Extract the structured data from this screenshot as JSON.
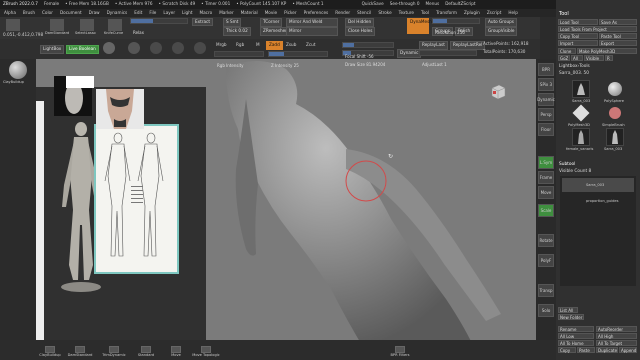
{
  "titlebar": {
    "app": "ZBrush 2022.0.7",
    "file": "Female",
    "free_mem": "• Free Mem 18.16GB",
    "active_mem": "• Active Mem 976",
    "scratch": "• Scratch Disk 49",
    "timer": "• Timer 0.001",
    "polycount": "• PolyCount 145.107 KP",
    "meshcount": "• MeshCount 1",
    "quicksave": "QuickSave",
    "seethrough": "See-through 0",
    "menus": "Menus",
    "default": "DefaultZScript"
  },
  "menu": [
    "Alpha",
    "Brush",
    "Color",
    "Document",
    "Draw",
    "Dynamics",
    "Edit",
    "File",
    "Layer",
    "Light",
    "Macro",
    "Marker",
    "Material",
    "Movie",
    "Picker",
    "Preferences",
    "Render",
    "Stencil",
    "Stroke",
    "Texture",
    "Tool",
    "Transform",
    "Zplugin",
    "Zscript",
    "Help"
  ],
  "shelf1": {
    "coords": "0.051,-0.412,0.798",
    "brushes": [
      "MoveBrush",
      "DamStandard",
      "SelectLasso",
      "KnifeCurve"
    ],
    "relax": "Relax",
    "extract": "Extract",
    "s_smt": "S Smt",
    "thick": "Thick 0.02",
    "tcorner": "TCorner",
    "tborder": "TBorder",
    "zremesher": "ZRemesher",
    "mirror_weld": "Mirror And Weld",
    "del_hidden": "Del Hidden",
    "mirror": "Mirror",
    "close_holes": "Close Holes",
    "dynamesh": "DynaMesh",
    "resolution": "Resolution 256",
    "groups": "Groups",
    "polish": "Polish",
    "auto_groups": "Auto Groups",
    "group_visible": "GroupVisible"
  },
  "shelf2": {
    "lightbox": "LightBox",
    "live_boolean": "Live Boolean",
    "mrgb": "Mrgb",
    "rgb": "Rgb",
    "m": "M",
    "zadd": "Zadd",
    "zsub": "Zsub",
    "zcut": "Zcut",
    "rgb_intensity": "Rgb Intensity",
    "z_intensity": "Z Intensity 25",
    "focal_shift": "Focal Shift -56",
    "draw_size": "Draw Size 81.94204",
    "dynamic": "Dynamic",
    "replay_last": "ReplayLast",
    "replay_last_rel": "ReplayLastRel",
    "active_points": "ActivePoints: 162,918",
    "total_points": "TotalPoints: 170,630",
    "adjust_last": "AdjustLast 1"
  },
  "left": {
    "brush": "ClayBuildup"
  },
  "canvas": {
    "pointer_label": "o"
  },
  "rightstrip": [
    "BPR",
    "SPix 3",
    "Dynamic",
    "Persp",
    "Floor",
    "L.Sym",
    "Frame",
    "Move",
    "Scale",
    "Rotate",
    "PolyF",
    "Transp",
    "Solo"
  ],
  "toolpanel": {
    "header": "Tool",
    "load_tool": "Load Tool",
    "save_as": "Save As",
    "load_tools_project": "Load Tools From Project",
    "copy_tool": "Copy Tool",
    "paste_tool": "Paste Tool",
    "import": "Import",
    "export": "Export",
    "clone": "Clone",
    "make_polymesh": "Make PolyMesh3D",
    "goz": "GoZ",
    "all": "All",
    "visible": "Visible",
    "r": "R",
    "lightbox_tools": "Lightbox›Tools",
    "sarra": "Sarra_003. 50",
    "tools": [
      "Sarra_003",
      "PolySphere",
      "PolyMesh3D",
      "SimpleBrush",
      "female_vanaris",
      "Sarra_003"
    ],
    "subtool": "Subtool",
    "visible_count": "Visible Count 8",
    "subtools": [
      "Sarra_003",
      "proportion_guides"
    ],
    "list_all": "List All",
    "new_folder": "New Folder",
    "rename": "Rename",
    "auto_reorder": "AutoReorder",
    "all_low": "All Low",
    "all_high": "All High",
    "all_to_home": "All To Home",
    "all_to_target": "All To Target",
    "copy": "Copy",
    "paste": "Paste",
    "duplicate": "Duplicate",
    "append": "Append"
  },
  "bottom": [
    "ClayBuildup",
    "DamStandard",
    "TrimDynamic",
    "Standard",
    "Move",
    "Move Topologic",
    "BPR Filters"
  ],
  "colors": {
    "accent": "#d9822b",
    "green": "#3f8f3f",
    "viewport": "#7b7b7b"
  }
}
